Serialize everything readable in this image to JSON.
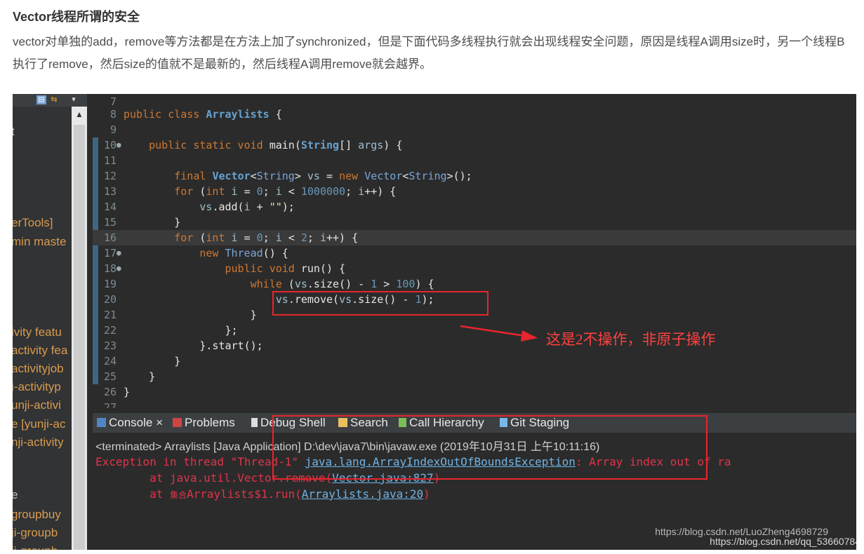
{
  "article": {
    "heading": "Vector线程所谓的安全",
    "paragraph": "vector对单独的add，remove等方法都是在方法上加了synchronized，但是下面代码多线程执行就会出现线程安全问题，原因是线程A调用size时，另一个线程B 执行了remove，然后size的值就不是最新的，然后线程A调用remove就会越界。"
  },
  "package_explorer": {
    "items": [
      "t",
      "erTools]",
      "min maste",
      "ivity featu",
      "activity fea",
      "activityjob",
      "i-activityp",
      "unji-activi",
      "e [yunji-ac",
      "nji-activity",
      "e",
      "groupbuy",
      "ji-groupb",
      "ji-groupb"
    ]
  },
  "editor": {
    "line_numbers": [
      "7",
      "8",
      "9",
      "10",
      "11",
      "12",
      "13",
      "14",
      "15",
      "16",
      "17",
      "18",
      "19",
      "20",
      "21",
      "22",
      "23",
      "24",
      "25",
      "26",
      "27"
    ]
  },
  "annotation": {
    "text": "这是2不操作，非原子操作"
  },
  "console": {
    "tabs": [
      {
        "label": "Console",
        "icon": "console-icon"
      },
      {
        "label": "Problems",
        "icon": "problems-icon"
      },
      {
        "label": "Debug Shell",
        "icon": "debug-shell-icon"
      },
      {
        "label": "Search",
        "icon": "search-icon"
      },
      {
        "label": "Call Hierarchy",
        "icon": "call-hierarchy-icon"
      },
      {
        "label": "Git Staging",
        "icon": "git-staging-icon"
      }
    ],
    "close_glyph": "×",
    "terminated_line": "<terminated> Arraylists [Java Application] D:\\dev\\java7\\bin\\javaw.exe (2019年10月31日 上午10:11:16)",
    "exception_prefix": "Exception in thread \"Thread-1\" ",
    "exception_class": "java.lang.ArrayIndexOutOfBoundsException",
    "exception_suffix": ": Array index out of ra",
    "trace1_prefix": "        at java.util.Vector.remove(",
    "trace1_link": "Vector.java:827",
    "trace1_suffix": ")",
    "trace2_prefix": "        at ",
    "trace2_cjk": "集合",
    "trace2_mid": "Arraylists$1.run(",
    "trace2_link": "Arraylists.java:20",
    "trace2_suffix": ")"
  },
  "watermark": {
    "line1": "https://blog.csdn.net/LuoZheng4698729",
    "line2": "https://blog.csdn.net/qq_53660784"
  },
  "colors": {
    "highlight_box": "#e8252d",
    "annotation": "#ff4040",
    "exception": "#e0344a"
  }
}
